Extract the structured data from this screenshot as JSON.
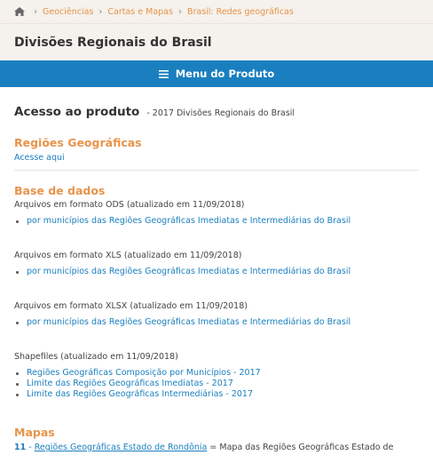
{
  "breadcrumb": {
    "items": [
      "Geociências",
      "Cartas e Mapas",
      "Brasil: Redes geográficas"
    ]
  },
  "header": {
    "title": "Divisões Regionais do Brasil"
  },
  "menu": {
    "label": "Menu do Produto"
  },
  "acesso": {
    "heading": "Acesso ao produto",
    "subtitle": "- 2017 Divisões Regionais do Brasil"
  },
  "regioes": {
    "title": "Regiões Geográficas",
    "link": "Acesse aqui"
  },
  "base": {
    "title": "Base de dados",
    "groups": [
      {
        "label": "Arquivos em formato ODS (atualizado em 11/09/2018)",
        "links": [
          "por municípios das Regiões Geográficas Imediatas e Intermediárias do Brasil"
        ]
      },
      {
        "label": "Arquivos em formato XLS (atualizado em 11/09/2018)",
        "links": [
          "por municípios das Regiões Geográficas Imediatas e Intermediárias do Brasil"
        ]
      },
      {
        "label": "Arquivos em formato XLSX (atualizado em 11/09/2018)",
        "links": [
          "por municípios das Regiões Geográficas Imediatas e Intermediárias do Brasil"
        ]
      },
      {
        "label": "Shapefiles (atualizado em 11/09/2018)",
        "links": [
          "Regiões Geográficas Composição por Municípios - 2017",
          "Limite das Regiões Geográficas Imediatas - 2017",
          "Limite das Regiões Geográficas Intermediárias - 2017"
        ]
      }
    ]
  },
  "mapas": {
    "title": "Mapas",
    "items": [
      {
        "num": "11",
        "sep": " - ",
        "link": "Regiões Geográficas Estado de Rondônia",
        "desc": " = Mapa das Regiões Geográficas Estado de"
      }
    ]
  },
  "colors": {
    "accent_orange": "#e8944a",
    "link_blue": "#1a7fbf",
    "menu_bg": "#1a7fbf",
    "header_bg": "#f5f1ec"
  },
  "icons": {
    "home": "home-icon",
    "chevron": "chevron-right-icon",
    "menu": "hamburger-icon"
  }
}
